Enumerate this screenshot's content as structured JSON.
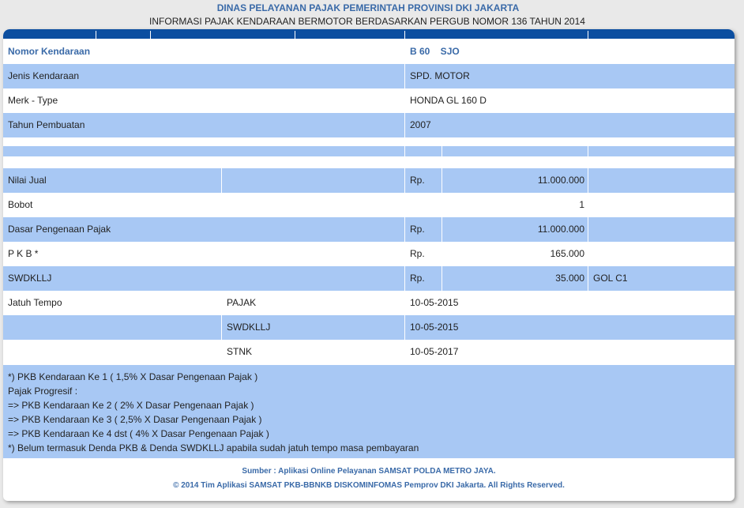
{
  "header": {
    "agency": "DINAS PELAYANAN PAJAK PEMERINTAH PROVINSI DKI JAKARTA",
    "subtitle": "INFORMASI PAJAK KENDARAAN BERMOTOR BERDASARKAN PERGUB NOMOR 136 TAHUN 2014"
  },
  "vehicle": {
    "nomor_label": "Nomor Kendaraan",
    "nomor_value": "B 60    SJO",
    "jenis_label": "Jenis Kendaraan",
    "jenis_value": "SPD. MOTOR",
    "merk_label": "Merk - Type",
    "merk_value": "HONDA GL 160 D",
    "tahun_label": "Tahun Pembuatan",
    "tahun_value": "2007"
  },
  "tax": {
    "nilai_jual_label": "Nilai Jual",
    "nilai_jual_cur": "Rp.",
    "nilai_jual_value": "11.000.000",
    "bobot_label": "Bobot",
    "bobot_value": "1",
    "dpp_label": "Dasar Pengenaan Pajak",
    "dpp_cur": "Rp.",
    "dpp_value": "11.000.000",
    "pkb_label": "P K B *",
    "pkb_cur": "Rp.",
    "pkb_value": "165.000",
    "swdkllj_label": "SWDKLLJ",
    "swdkllj_cur": "Rp.",
    "swdkllj_value": "35.000",
    "swdkllj_gol": "GOL C1"
  },
  "due": {
    "label": "Jatuh Tempo",
    "pajak_label": "PAJAK",
    "pajak_date": "10-05-2015",
    "swdkllj_label": "SWDKLLJ",
    "swdkllj_date": "10-05-2015",
    "stnk_label": "STNK",
    "stnk_date": "10-05-2017"
  },
  "notes": [
    "*) PKB Kendaraan Ke 1 ( 1,5% X Dasar Pengenaan Pajak )",
    "Pajak Progresif :",
    "=> PKB Kendaraan Ke 2 ( 2% X Dasar Pengenaan Pajak )",
    "=> PKB Kendaraan Ke 3 ( 2,5% X Dasar Pengenaan Pajak )",
    "=> PKB Kendaraan Ke 4 dst ( 4% X Dasar Pengenaan Pajak )",
    "*) Belum termasuk Denda PKB & Denda SWDKLLJ apabila sudah jatuh tempo masa pembayaran"
  ],
  "footer": {
    "source": "Sumber : Aplikasi Online Pelayanan SAMSAT POLDA METRO JAYA.",
    "copyright": "© 2014 Tim Aplikasi SAMSAT PKB-BBNKB DISKOMINFOMAS Pemprov DKI Jakarta. All Rights Reserved."
  }
}
